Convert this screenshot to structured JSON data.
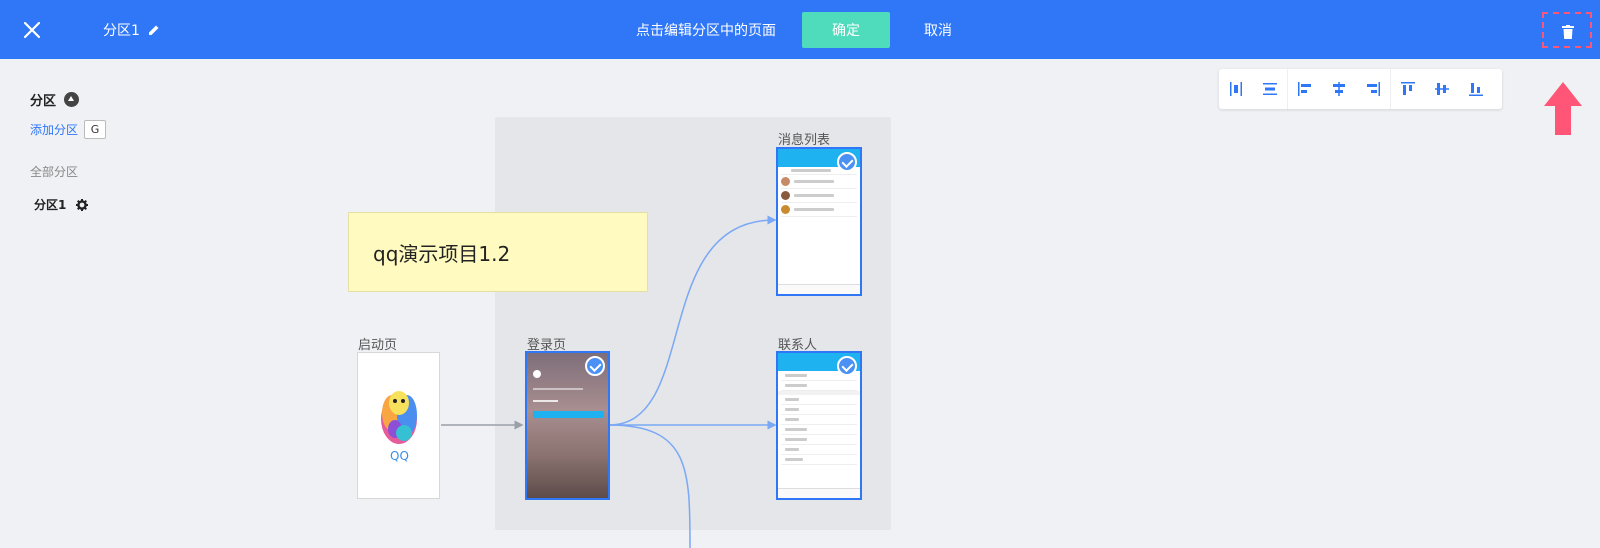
{
  "topbar": {
    "section_name": "分区1",
    "hint": "点击编辑分区中的页面",
    "confirm_label": "确定",
    "cancel_label": "取消"
  },
  "left_panel": {
    "header": "分区",
    "add_label": "添加分区",
    "add_shortcut": "G",
    "all_label": "全部分区",
    "items": [
      {
        "label": "分区1"
      }
    ]
  },
  "canvas": {
    "sticky_note": "qq演示项目1.2",
    "pages": [
      {
        "label": "启动页",
        "selected": false
      },
      {
        "label": "登录页",
        "selected": true
      },
      {
        "label": "消息列表",
        "selected": true
      },
      {
        "label": "联系人",
        "selected": true
      }
    ],
    "splash_logo_text": "QQ"
  },
  "toolbar": {
    "tools": [
      "distribute-horizontal-icon",
      "distribute-vertical-icon",
      "align-left-icon",
      "align-center-horizontal-icon",
      "align-right-icon",
      "align-top-icon",
      "align-middle-vertical-icon",
      "align-bottom-icon"
    ]
  },
  "colors": {
    "primary": "#2f77f7",
    "confirm": "#4fdcbc",
    "delete_highlight": "#ff5576"
  }
}
